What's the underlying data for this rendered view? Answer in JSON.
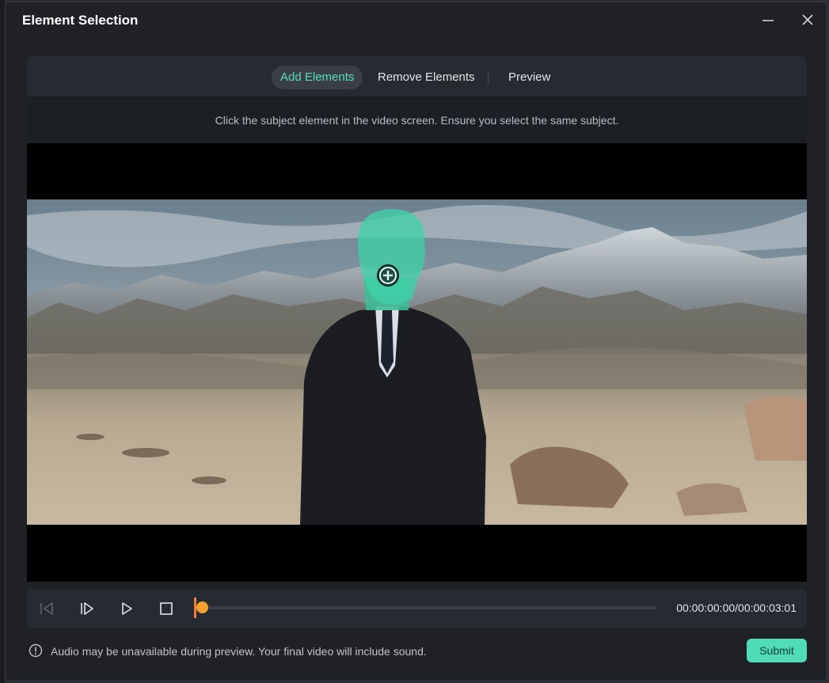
{
  "window": {
    "title": "Element Selection"
  },
  "tabs": [
    {
      "label": "Add Elements",
      "active": true
    },
    {
      "label": "Remove Elements",
      "active": false
    },
    {
      "label": "Preview",
      "active": false
    }
  ],
  "hint": "Click the subject element in the video screen. Ensure you select the same subject.",
  "player": {
    "timecode": "00:00:00:00/00:00:03:01",
    "progress": 0
  },
  "footer": {
    "note": "Audio may be unavailable during preview. Your final video will include sound.",
    "submit_label": "Submit"
  },
  "colors": {
    "accent": "#57dcbd",
    "submit_bg": "#4fdcb7",
    "playhead": "#f7a12e",
    "mask": "#3fd1a8"
  },
  "icons": [
    "minimize-icon",
    "close-icon",
    "prev-frame-icon",
    "next-frame-icon",
    "play-icon",
    "stop-icon",
    "add-point-icon",
    "info-icon"
  ]
}
